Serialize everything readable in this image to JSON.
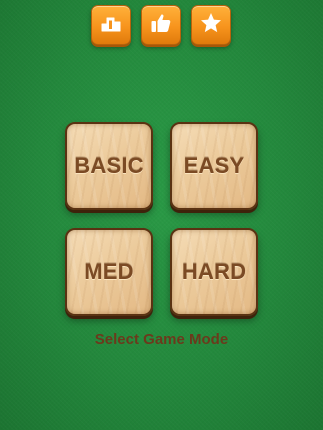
{
  "toolbar": {
    "icons": [
      "leaderboard-icon",
      "thumbs-up-icon",
      "star-icon"
    ]
  },
  "modes": [
    {
      "label": "BASIC"
    },
    {
      "label": "EASY"
    },
    {
      "label": "MED"
    },
    {
      "label": "HARD"
    }
  ],
  "caption": "Select Game Mode",
  "colors": {
    "felt": "#23883c",
    "button_orange": "#f7941d",
    "tile_wood": "#eccb9c",
    "tile_text": "#7b4a24",
    "caption_text": "#6b3a1c"
  }
}
